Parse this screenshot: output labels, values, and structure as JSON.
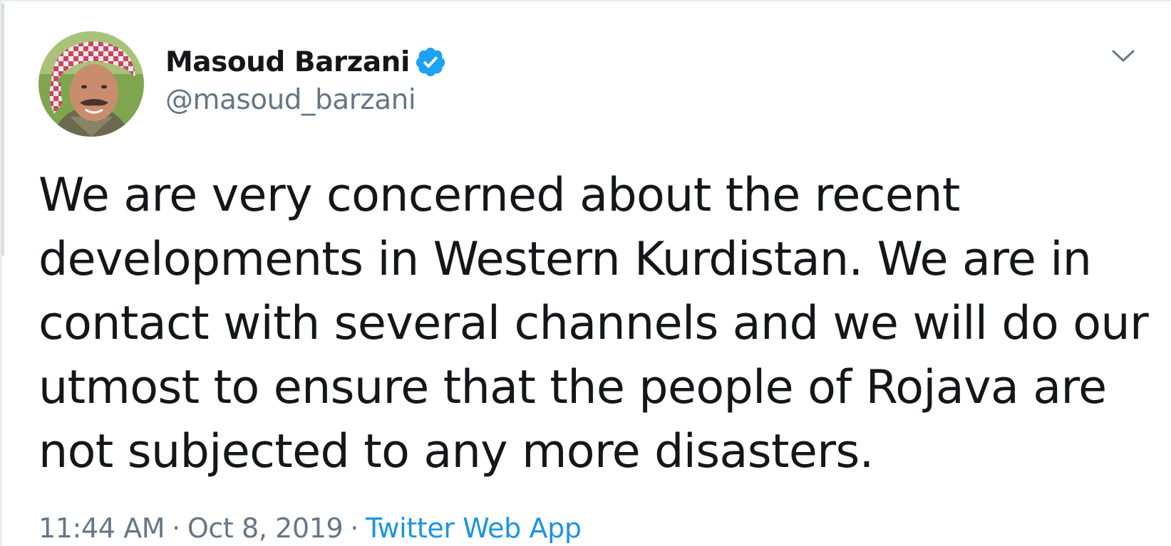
{
  "author": {
    "display_name": "Masoud Barzani",
    "handle": "@masoud_barzani",
    "verified": true,
    "avatar_icon": "profile-photo-avatar"
  },
  "tweet": {
    "text": "We are very concerned about the recent developments in Western Kurdistan. We are in contact with several channels and we will do our utmost to ensure that the people of Rojava are not subjected to any more disasters."
  },
  "meta": {
    "time": "11:44 AM",
    "separator": "·",
    "date": "Oct 8, 2019",
    "source": "Twitter Web App"
  },
  "icons": {
    "verified": "verified-badge-icon",
    "menu": "chevron-down-icon"
  },
  "colors": {
    "accent": "#1b95e0",
    "verified": "#1da1f2",
    "text_primary": "#14171a",
    "text_secondary": "#657786"
  }
}
